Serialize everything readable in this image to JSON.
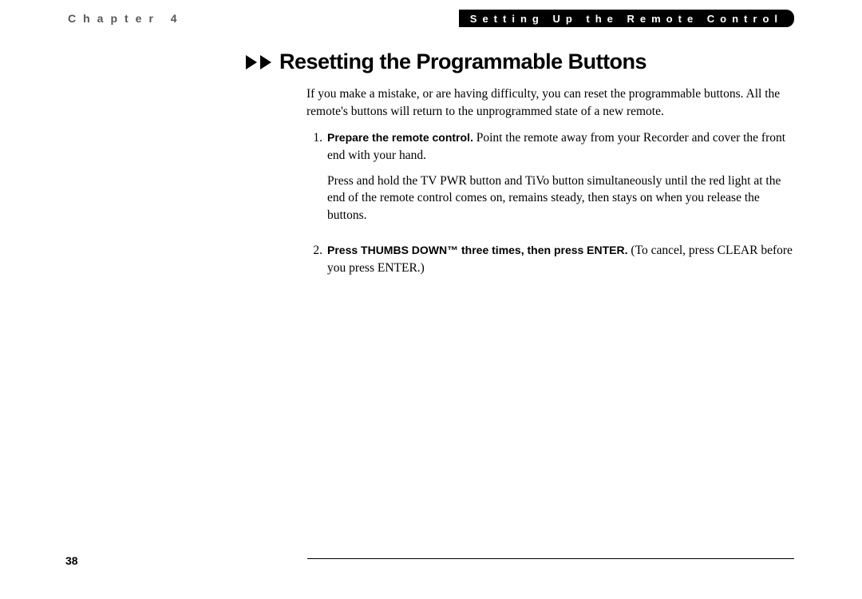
{
  "header": {
    "chapter_label": "Chapter 4",
    "section_title": "Setting Up the Remote Control"
  },
  "heading": "Resetting the Programmable Buttons",
  "intro": "If you make a mistake, or are having difficulty, you can reset the programmable buttons. All the remote's buttons will return to the unprogrammed state of a new remote.",
  "steps": [
    {
      "num": "1.",
      "bold": "Prepare the remote control.",
      "rest": " Point the remote away from your Recorder and cover the front end with your hand.",
      "para2": "Press and hold the TV PWR button and TiVo button simultaneously until the red light at the end of the remote control comes on, remains steady, then stays on when you release the buttons."
    },
    {
      "num": "2.",
      "bold": "Press THUMBS DOWN™ three times, then press ENTER.",
      "rest": " (To cancel, press CLEAR before you press ENTER.)",
      "para2": ""
    }
  ],
  "page_number": "38"
}
